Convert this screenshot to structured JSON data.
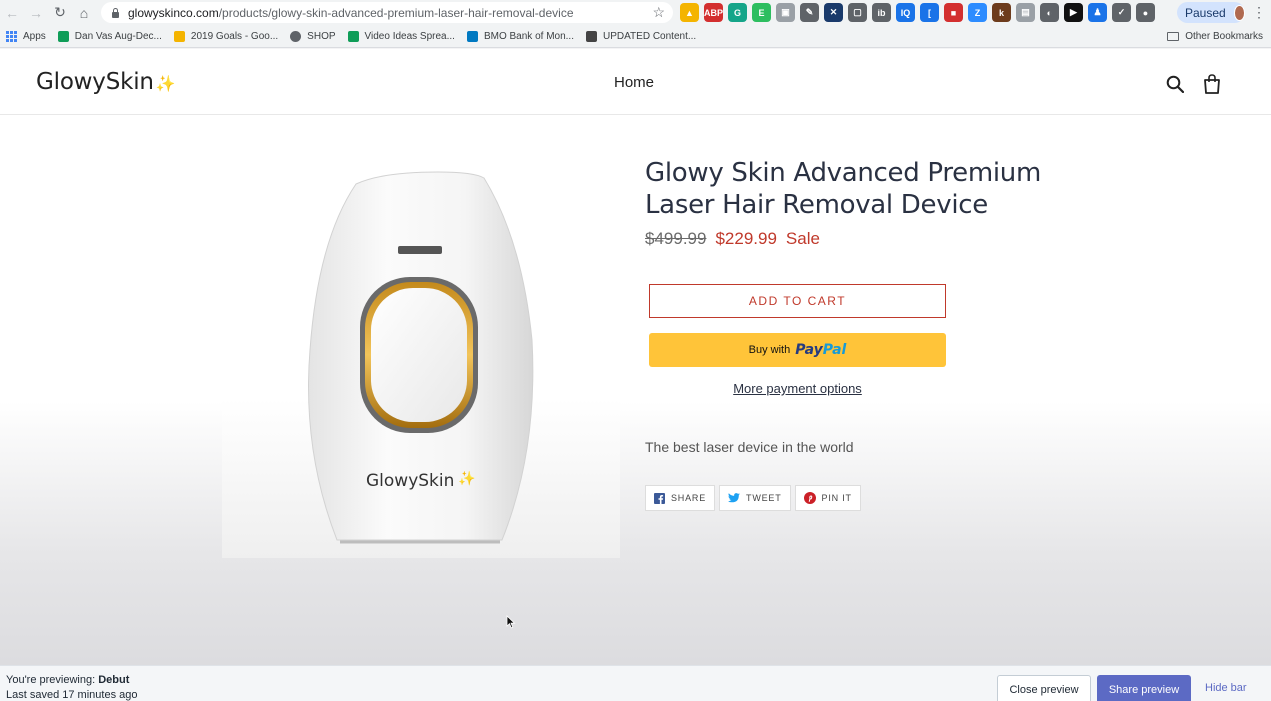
{
  "browser": {
    "url_host": "glowyskinco.com",
    "url_path": "/products/glowy-skin-advanced-premium-laser-hair-removal-device",
    "profile_status": "Paused",
    "extensions": [
      {
        "icon": "drive-icon",
        "color": "#f4b400",
        "glyph": "▲"
      },
      {
        "icon": "abp-icon",
        "color": "#d32f2f",
        "glyph": "ABP"
      },
      {
        "icon": "grammarly-icon",
        "color": "#15a589",
        "glyph": "G"
      },
      {
        "icon": "evernote-icon",
        "color": "#2dbe60",
        "glyph": "E"
      },
      {
        "icon": "extension-icon",
        "color": "#9aa0a6",
        "glyph": "▣"
      },
      {
        "icon": "color-picker-icon",
        "color": "#5f6368",
        "glyph": "✎"
      },
      {
        "icon": "crosshair-icon",
        "color": "#1a3a6b",
        "glyph": "✕"
      },
      {
        "icon": "window-icon",
        "color": "#5f6368",
        "glyph": "▢"
      },
      {
        "icon": "ib-icon",
        "color": "#5f6368",
        "glyph": "ib"
      },
      {
        "icon": "iq-icon",
        "color": "#1a73e8",
        "glyph": "IQ"
      },
      {
        "icon": "bracket-icon",
        "color": "#1a73e8",
        "glyph": "["
      },
      {
        "icon": "red-icon",
        "color": "#d32f2f",
        "glyph": "■"
      },
      {
        "icon": "zoom-icon",
        "color": "#2d8cff",
        "glyph": "Z"
      },
      {
        "icon": "k-icon",
        "color": "#6d3b1c",
        "glyph": "k"
      },
      {
        "icon": "gray-icon",
        "color": "#9aa0a6",
        "glyph": "▤"
      },
      {
        "icon": "round-icon",
        "color": "#5f6368",
        "glyph": "◐"
      },
      {
        "icon": "play-icon",
        "color": "#111111",
        "glyph": "▶"
      },
      {
        "icon": "person-icon",
        "color": "#1a73e8",
        "glyph": "♟"
      },
      {
        "icon": "check-icon",
        "color": "#5f6368",
        "glyph": "✓"
      },
      {
        "icon": "bulb-icon",
        "color": "#5f6368",
        "glyph": "●"
      }
    ]
  },
  "bookmarks": {
    "items": [
      {
        "label": "Apps",
        "icon": "apps-grid-icon",
        "color": "#4285f4"
      },
      {
        "label": "Dan Vas Aug-Dec...",
        "icon": "sheets-icon",
        "color": "#0f9d58"
      },
      {
        "label": "2019 Goals - Goo...",
        "icon": "drive-icon",
        "color": "#f4b400"
      },
      {
        "label": "SHOP",
        "icon": "globe-icon",
        "color": "#5f6368"
      },
      {
        "label": "Video Ideas Sprea...",
        "icon": "sheets-icon",
        "color": "#0f9d58"
      },
      {
        "label": "BMO Bank of Mon...",
        "icon": "bank-icon",
        "color": "#0079c1"
      },
      {
        "label": "UPDATED Content...",
        "icon": "doc-icon",
        "color": "#444444"
      }
    ],
    "other": "Other Bookmarks"
  },
  "store": {
    "logo": "GlowySkin",
    "logo_spark": "✨",
    "nav_home": "Home"
  },
  "product": {
    "title": "Glowy Skin Advanced Premium Laser Hair Removal Device",
    "price_original": "$499.99",
    "price_sale": "$229.99",
    "price_label": "Sale",
    "add_to_cart": "ADD TO CART",
    "buy_with": "Buy with",
    "paypal_1": "Pay",
    "paypal_2": "Pal",
    "more_payment": "More payment options",
    "description": "The best laser device in the world",
    "device_logo": "GlowySkin",
    "share": [
      {
        "label": "SHARE",
        "icon": "facebook-icon",
        "color": "#3b5998"
      },
      {
        "label": "TWEET",
        "icon": "twitter-icon",
        "color": "#1da1f2"
      },
      {
        "label": "PIN IT",
        "icon": "pinterest-icon",
        "color": "#cb2027"
      }
    ]
  },
  "preview_bar": {
    "prefix": "You're previewing:",
    "theme": "Debut",
    "last_saved": "Last saved 17 minutes ago",
    "close_preview": "Close preview",
    "share_preview": "Share preview",
    "hide_bar": "Hide bar"
  },
  "colors": {
    "sale": "#c0392b",
    "paypal_bg": "#ffc439",
    "share_preview_bg": "#5c6ac4"
  }
}
